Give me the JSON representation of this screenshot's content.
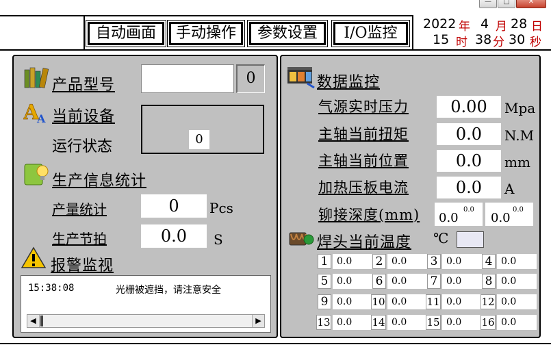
{
  "window_controls": [
    "—",
    "□",
    "✕"
  ],
  "tabs": [
    "自动画面",
    "手动操作",
    "参数设置",
    "I/O监控"
  ],
  "datetime": {
    "year": "2022",
    "year_unit": "年",
    "month": "4",
    "month_unit": "月",
    "day": "28",
    "day_unit": "日",
    "hour": "15",
    "hour_unit": "时",
    "minute": "38",
    "minute_unit": "分",
    "second": "30",
    "second_unit": "秒"
  },
  "left": {
    "product_model_label": "产品型号",
    "product_model_value": "",
    "product_model_num": "0",
    "current_device_label": "当前设备",
    "run_state_label": "运行状态",
    "run_state_value": "0",
    "production_stats_title": "生产信息统计",
    "output_label": "产量统计",
    "output_value": "0",
    "output_unit": "Pcs",
    "cycle_label": "生产节拍",
    "cycle_value": "0.0",
    "cycle_unit": "S",
    "alarm_title": "报警监视",
    "alarm_time": "15:38:08",
    "alarm_message": "光栅被遮挡，请注意安全",
    "scroll_left": "◀",
    "scroll_right": "▶"
  },
  "right": {
    "title": "数据监控",
    "rows": [
      {
        "label": "气源实时压力",
        "value": "0.00",
        "unit": "Mpa"
      },
      {
        "label": "主轴当前扭矩",
        "value": "0.0",
        "unit": "N.M"
      },
      {
        "label": "主轴当前位置",
        "value": "0.0",
        "unit": "mm"
      },
      {
        "label": "加热压板电流",
        "value": "0.0",
        "unit": "A"
      }
    ],
    "rivet_label": "铆接深度(mm)",
    "rivet_values": [
      {
        "value": "0.0",
        "sup": "0.0"
      },
      {
        "value": "0.0",
        "sup": "0.0"
      }
    ],
    "weld_temp_label": "焊头当前温度",
    "temp_unit": "℃",
    "temps": [
      {
        "num": "1",
        "value": "0.0"
      },
      {
        "num": "2",
        "value": "0.0"
      },
      {
        "num": "3",
        "value": "0.0"
      },
      {
        "num": "4",
        "value": "0.0"
      },
      {
        "num": "5",
        "value": "0.0"
      },
      {
        "num": "6",
        "value": "0.0"
      },
      {
        "num": "7",
        "value": "0.0"
      },
      {
        "num": "8",
        "value": "0.0"
      },
      {
        "num": "9",
        "value": "0.0"
      },
      {
        "num": "10",
        "value": "0.0"
      },
      {
        "num": "11",
        "value": "0.0"
      },
      {
        "num": "12",
        "value": "0.0"
      },
      {
        "num": "13",
        "value": "0.0"
      },
      {
        "num": "14",
        "value": "0.0"
      },
      {
        "num": "15",
        "value": "0.0"
      },
      {
        "num": "16",
        "value": "0.0"
      }
    ]
  },
  "colors": {
    "panel_bg": "#c0c0c0",
    "datetime_unit": "#c00000",
    "temp_indicator": "#e8e8f4"
  }
}
